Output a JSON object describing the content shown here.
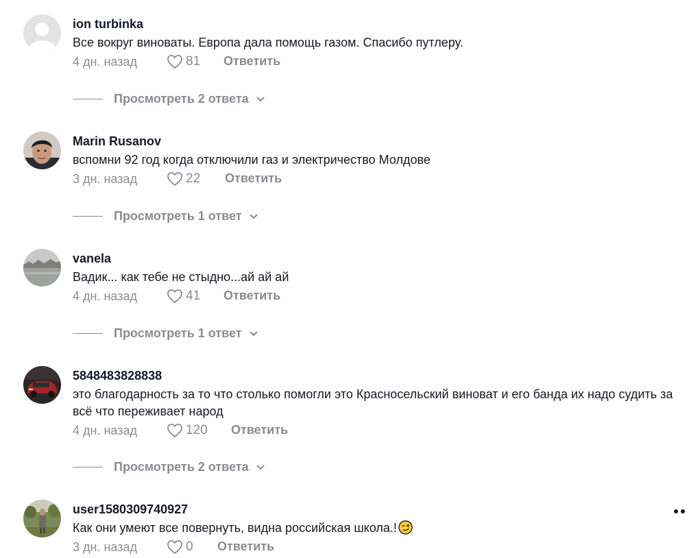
{
  "comments": [
    {
      "username": "ion turbinka",
      "text": "Все вокруг виноваты. Европа дала помощь газом. Спасибо путлеру.",
      "date": "4 дн. назад",
      "likes": "81",
      "reply_label": "Ответить",
      "view_replies": "Просмотреть 2 ответа"
    },
    {
      "username": "Marin Rusanov",
      "text": "вспомни 92 год когда отключили газ и электричество Молдове",
      "date": "3 дн. назад",
      "likes": "22",
      "reply_label": "Ответить",
      "view_replies": "Просмотреть 1 ответ"
    },
    {
      "username": "vanela",
      "text": "Вадик... как тебе не стыдно...ай ай ай",
      "date": "4 дн. назад",
      "likes": "41",
      "reply_label": "Ответить",
      "view_replies": "Просмотреть 1 ответ"
    },
    {
      "username": "5848483828838",
      "text": "это благодарность за то что столько помогли это Красносельский виноват и его банда их надо судить за всё что переживает народ",
      "date": "4 дн. назад",
      "likes": "120",
      "reply_label": "Ответить",
      "view_replies": "Просмотреть 2 ответа"
    },
    {
      "username": "user1580309740927",
      "text": "Как они умеют все повернуть, видна российская школа.!",
      "emoji": "smirk-emoji",
      "date": "3 дн. назад",
      "likes": "0",
      "reply_label": "Ответить"
    }
  ],
  "colors": {
    "text_primary": "#161823",
    "text_secondary": "#8a8b91",
    "background": "#ffffff"
  }
}
